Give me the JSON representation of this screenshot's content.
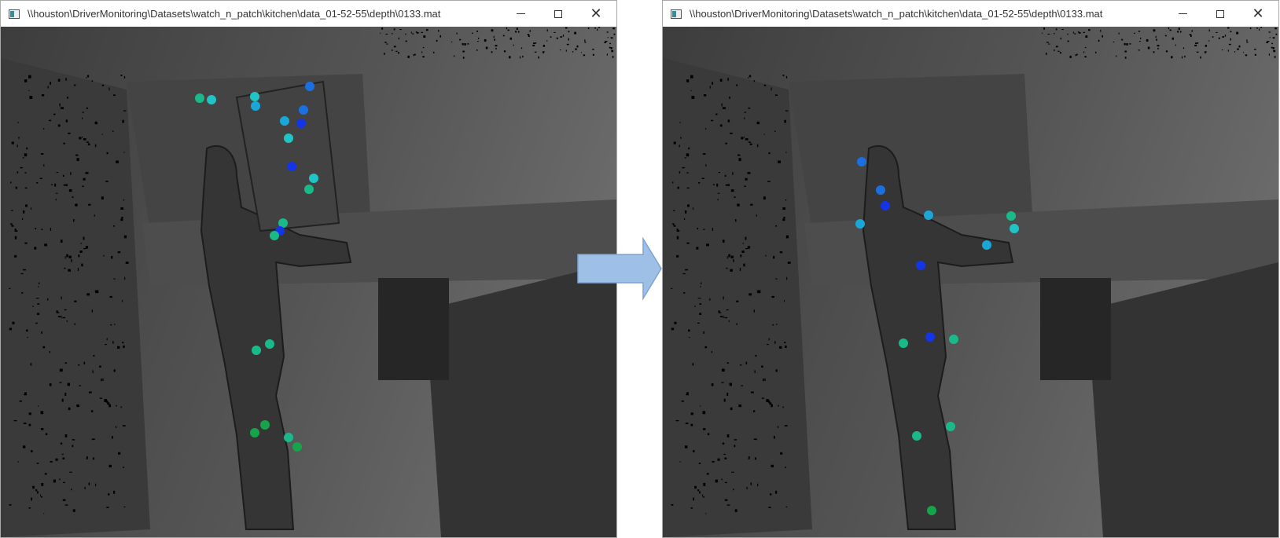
{
  "left_window": {
    "title": "\\\\houston\\DriverMonitoring\\Datasets\\watch_n_patch\\kitchen\\data_01-52-55\\depth\\0133.mat",
    "controls": {
      "minimize": "minimize",
      "maximize": "maximize",
      "close": "✕"
    }
  },
  "right_window": {
    "title": "\\\\houston\\DriverMonitoring\\Datasets\\watch_n_patch\\kitchen\\data_01-52-55\\depth\\0133.mat",
    "controls": {
      "minimize": "minimize",
      "maximize": "maximize",
      "close": "✕"
    }
  },
  "colors": {
    "depth_far": "#4a4a4a",
    "depth_mid": "#3b3b3b",
    "person": "#353535",
    "arrow_fill": "#9ec0e6",
    "arrow_stroke": "#7fa4cf",
    "joint_palette": [
      "#1ab98a",
      "#21c4c6",
      "#1aa7d8",
      "#1b6fe0",
      "#1434e8",
      "#16a34a"
    ]
  },
  "icons": {
    "window_icon": "app-window-icon",
    "arrow": "right-arrow-icon"
  }
}
